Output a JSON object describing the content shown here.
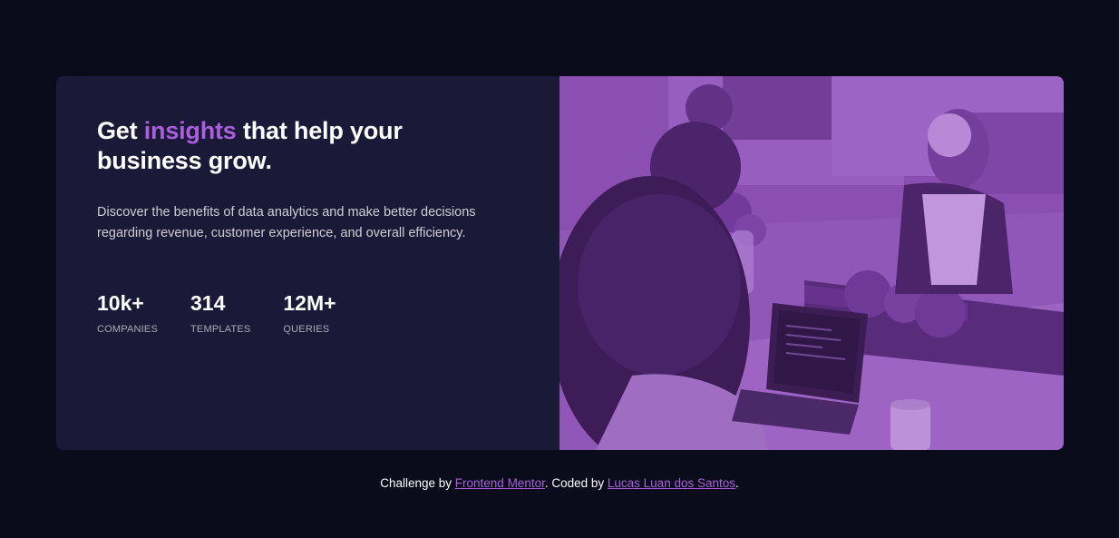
{
  "card": {
    "headline": {
      "before": "Get ",
      "accent": "insights",
      "after": " that help your business grow."
    },
    "description": "Discover the benefits of data analytics and make better decisions regarding revenue, customer experience, and overall efficiency.",
    "stats": [
      {
        "value": "10k+",
        "label": "COMPANIES"
      },
      {
        "value": "314",
        "label": "TEMPLATES"
      },
      {
        "value": "12M+",
        "label": "QUERIES"
      }
    ]
  },
  "footer": {
    "prefix": "Challenge by ",
    "link1": "Frontend Mentor",
    "middle": ". Coded by ",
    "link2": "Lucas Luan dos Santos",
    "suffix": "."
  },
  "colors": {
    "background": "#0a0c1c",
    "card": "#1b1938",
    "accent": "#a95fdc",
    "image_overlay": "#8a4fb2"
  }
}
